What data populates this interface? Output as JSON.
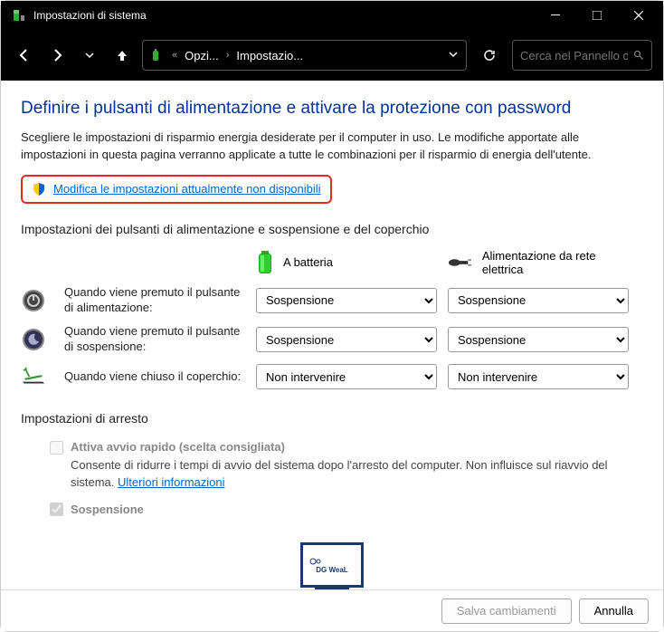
{
  "window": {
    "title": "Impostazioni di sistema"
  },
  "nav": {
    "crumb_prefix": "«",
    "crumb1": "Opzi...",
    "crumb2": "Impostazio...",
    "search_placeholder": "Cerca nel Pannello d..."
  },
  "page": {
    "heading": "Definire i pulsanti di alimentazione e attivare la protezione con password",
    "description": "Scegliere le impostazioni di risparmio energia desiderate per il computer in uso. Le modifiche apportate alle impostazioni in questa pagina verranno applicate a tutte le combinazioni per il risparmio di energia dell'utente.",
    "admin_link": "Modifica le impostazioni attualmente non disponibili"
  },
  "power": {
    "section_title": "Impostazioni dei pulsanti di alimentazione e sospensione e del coperchio",
    "col_battery": "A batteria",
    "col_ac": "Alimentazione da rete elettrica",
    "rows": [
      {
        "label": "Quando viene premuto il pulsante di alimentazione:",
        "battery": "Sospensione",
        "ac": "Sospensione"
      },
      {
        "label": "Quando viene premuto il pulsante di sospensione:",
        "battery": "Sospensione",
        "ac": "Sospensione"
      },
      {
        "label": "Quando viene chiuso il coperchio:",
        "battery": "Non intervenire",
        "ac": "Non intervenire"
      }
    ]
  },
  "shutdown": {
    "section_title": "Impostazioni di arresto",
    "fast_title": "Attiva avvio rapido (scelta consigliata)",
    "fast_desc": "Consente di ridurre i tempi di avvio del sistema dopo l'arresto del computer. Non influisce sul riavvio del sistema. ",
    "fast_link": "Ulteriori informazioni",
    "sleep_title": "Sospensione"
  },
  "footer": {
    "save": "Salva cambiamenti",
    "cancel": "Annulla"
  },
  "logo": {
    "text": "DG WeaL"
  }
}
